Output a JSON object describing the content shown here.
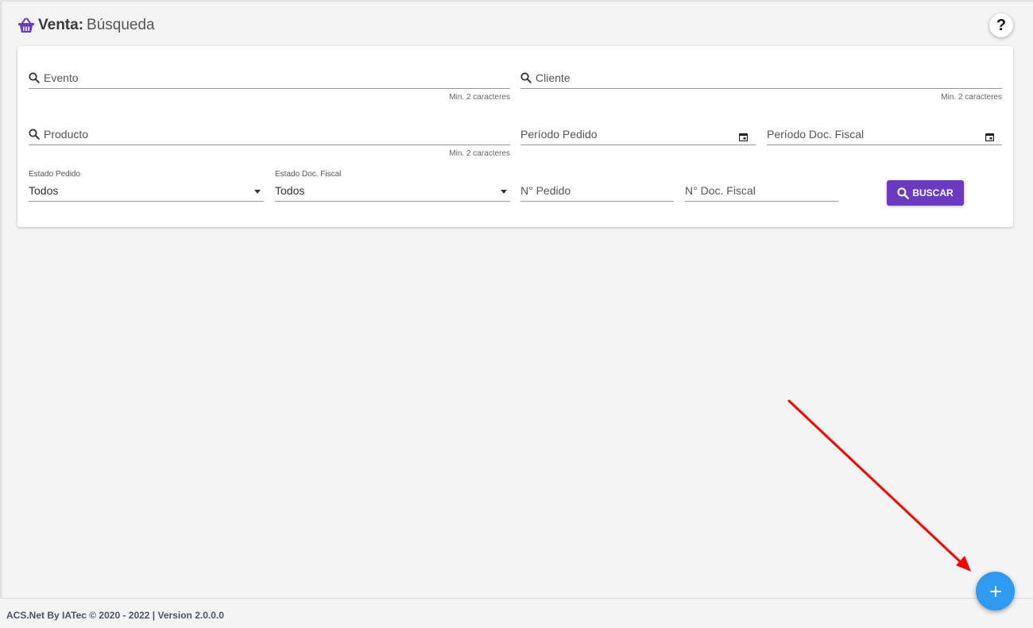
{
  "header": {
    "title_strong": "Venta:",
    "title_light": "Búsqueda",
    "icon": "basket-icon",
    "help_label": "?"
  },
  "search": {
    "evento": {
      "placeholder": "Evento",
      "hint": "Min. 2 caracteres",
      "icon": "search-icon"
    },
    "cliente": {
      "placeholder": "Cliente",
      "hint": "Min. 2 caracteres",
      "icon": "search-icon"
    },
    "producto": {
      "placeholder": "Producto",
      "hint": "Min. 2 caracteres",
      "icon": "search-icon"
    },
    "periodo_pedido": {
      "placeholder": "Período Pedido",
      "icon": "calendar-icon"
    },
    "periodo_doc_fiscal": {
      "placeholder": "Período Doc. Fiscal",
      "icon": "calendar-icon"
    },
    "estado_pedido": {
      "label": "Estado Pedido",
      "value": "Todos"
    },
    "estado_doc_fiscal": {
      "label": "Estado Doc. Fiscal",
      "value": "Todos"
    },
    "numero_pedido": {
      "placeholder": "N° Pedido"
    },
    "numero_doc_fiscal": {
      "placeholder": "N° Doc. Fiscal"
    },
    "buscar_label": "BUSCAR"
  },
  "footer": {
    "text": "ACS.Net By IATec © 2020 - 2022 | Version 2.0.0.0"
  },
  "fab": {
    "label": "+",
    "icon": "plus-icon"
  },
  "colors": {
    "accent": "#6a3bc2",
    "fab": "#2f9bf0",
    "annotation_arrow": "#ff0000",
    "background": "#f4f4f4"
  }
}
